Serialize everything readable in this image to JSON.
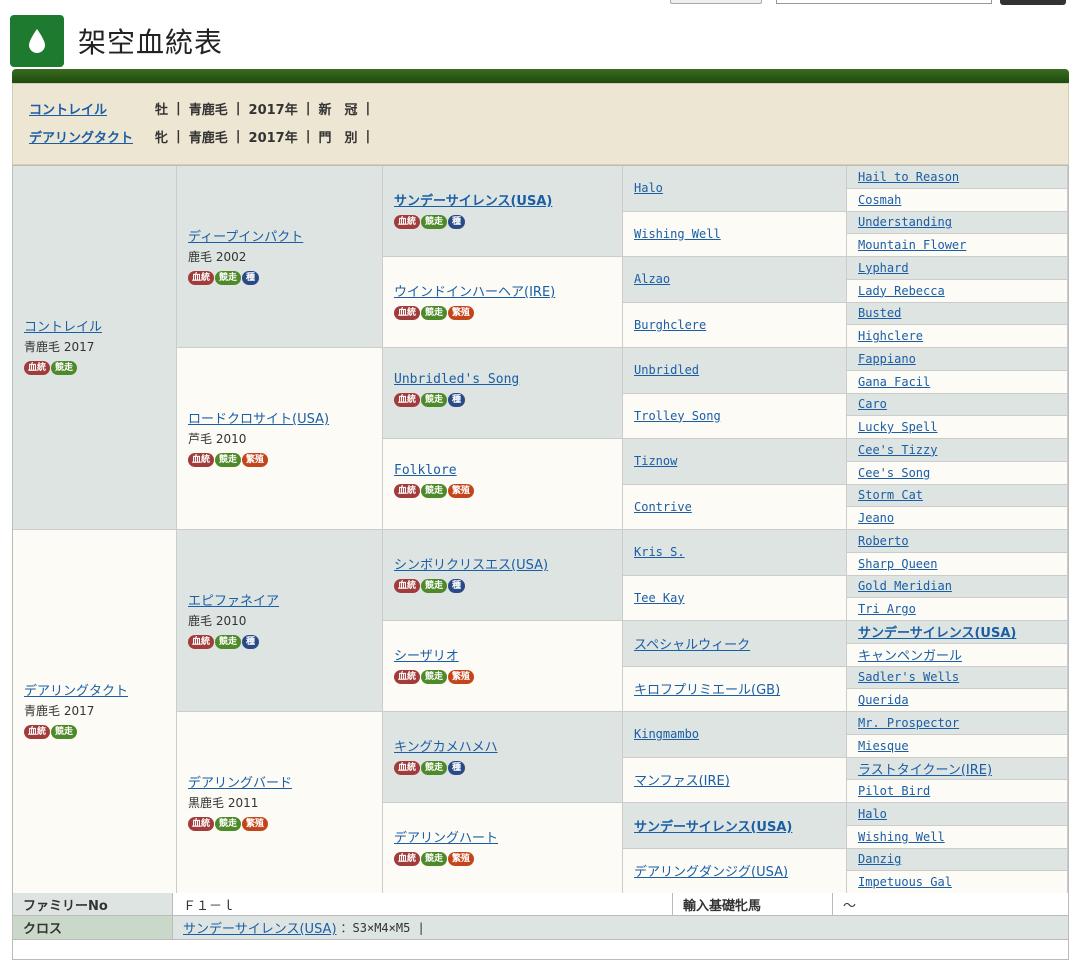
{
  "page_title": "架空血統表",
  "badges": {
    "ketto": "血統",
    "kyoso": "競走",
    "shu": "種",
    "hanshoku": "繁殖"
  },
  "summary": [
    {
      "name": "コントレイル",
      "sex": "牡",
      "color": "青鹿毛",
      "year": "2017年",
      "note": "新　冠"
    },
    {
      "name": "デアリングタクト",
      "sex": "牝",
      "color": "青鹿毛",
      "year": "2017年",
      "note": "門　別"
    }
  ],
  "gen1": [
    {
      "name": "コントレイル",
      "sub": "青鹿毛 2017"
    },
    {
      "name": "デアリングタクト",
      "sub": "青鹿毛 2017"
    }
  ],
  "gen2": [
    {
      "name": "ディープインパクト",
      "sub": "鹿毛 2002"
    },
    {
      "name": "ロードクロサイト(USA)",
      "sub": "芦毛 2010"
    },
    {
      "name": "エピファネイア",
      "sub": "鹿毛 2010"
    },
    {
      "name": "デアリングバード",
      "sub": "黒鹿毛 2011"
    }
  ],
  "gen3": [
    {
      "name": "サンデーサイレンス(USA)"
    },
    {
      "name": "ウインドインハーヘア(IRE)"
    },
    {
      "name": "Unbridled's Song"
    },
    {
      "name": "Folklore"
    },
    {
      "name": "シンボリクリスエス(USA)"
    },
    {
      "name": "シーザリオ"
    },
    {
      "name": "キングカメハメハ"
    },
    {
      "name": "デアリングハート"
    }
  ],
  "gen4": [
    "Halo",
    "Wishing Well",
    "Alzao",
    "Burghclere",
    "Unbridled",
    "Trolley Song",
    "Tiznow",
    "Contrive",
    "Kris S.",
    "Tee Kay",
    "スペシャルウィーク",
    "キロフプリミエール(GB)",
    "Kingmambo",
    "マンファス(IRE)",
    "サンデーサイレンス(USA)",
    "デアリングダンジグ(USA)"
  ],
  "gen5": [
    "Hail to Reason",
    "Cosmah",
    "Understanding",
    "Mountain Flower",
    "Lyphard",
    "Lady Rebecca",
    "Busted",
    "Highclere",
    "Fappiano",
    "Gana Facil",
    "Caro",
    "Lucky Spell",
    "Cee's Tizzy",
    "Cee's Song",
    "Storm Cat",
    "Jeano",
    "Roberto",
    "Sharp Queen",
    "Gold Meridian",
    "Tri Argo",
    "サンデーサイレンス(USA)",
    "キャンペンガール",
    "Sadler's Wells",
    "Querida",
    "Mr. Prospector",
    "Miesque",
    "ラストタイクーン(IRE)",
    "Pilot Bird",
    "Halo",
    "Wishing Well",
    "Danzig",
    "Impetuous Gal"
  ],
  "family": {
    "label": "ファミリーNo",
    "value": "Ｆ１－ｌ",
    "import_label": "輸入基礎牝馬",
    "import_value": "～"
  },
  "cross": {
    "label": "クロス",
    "link": "サンデーサイレンス(USA)",
    "value": "：S3×M4×M5 |"
  }
}
